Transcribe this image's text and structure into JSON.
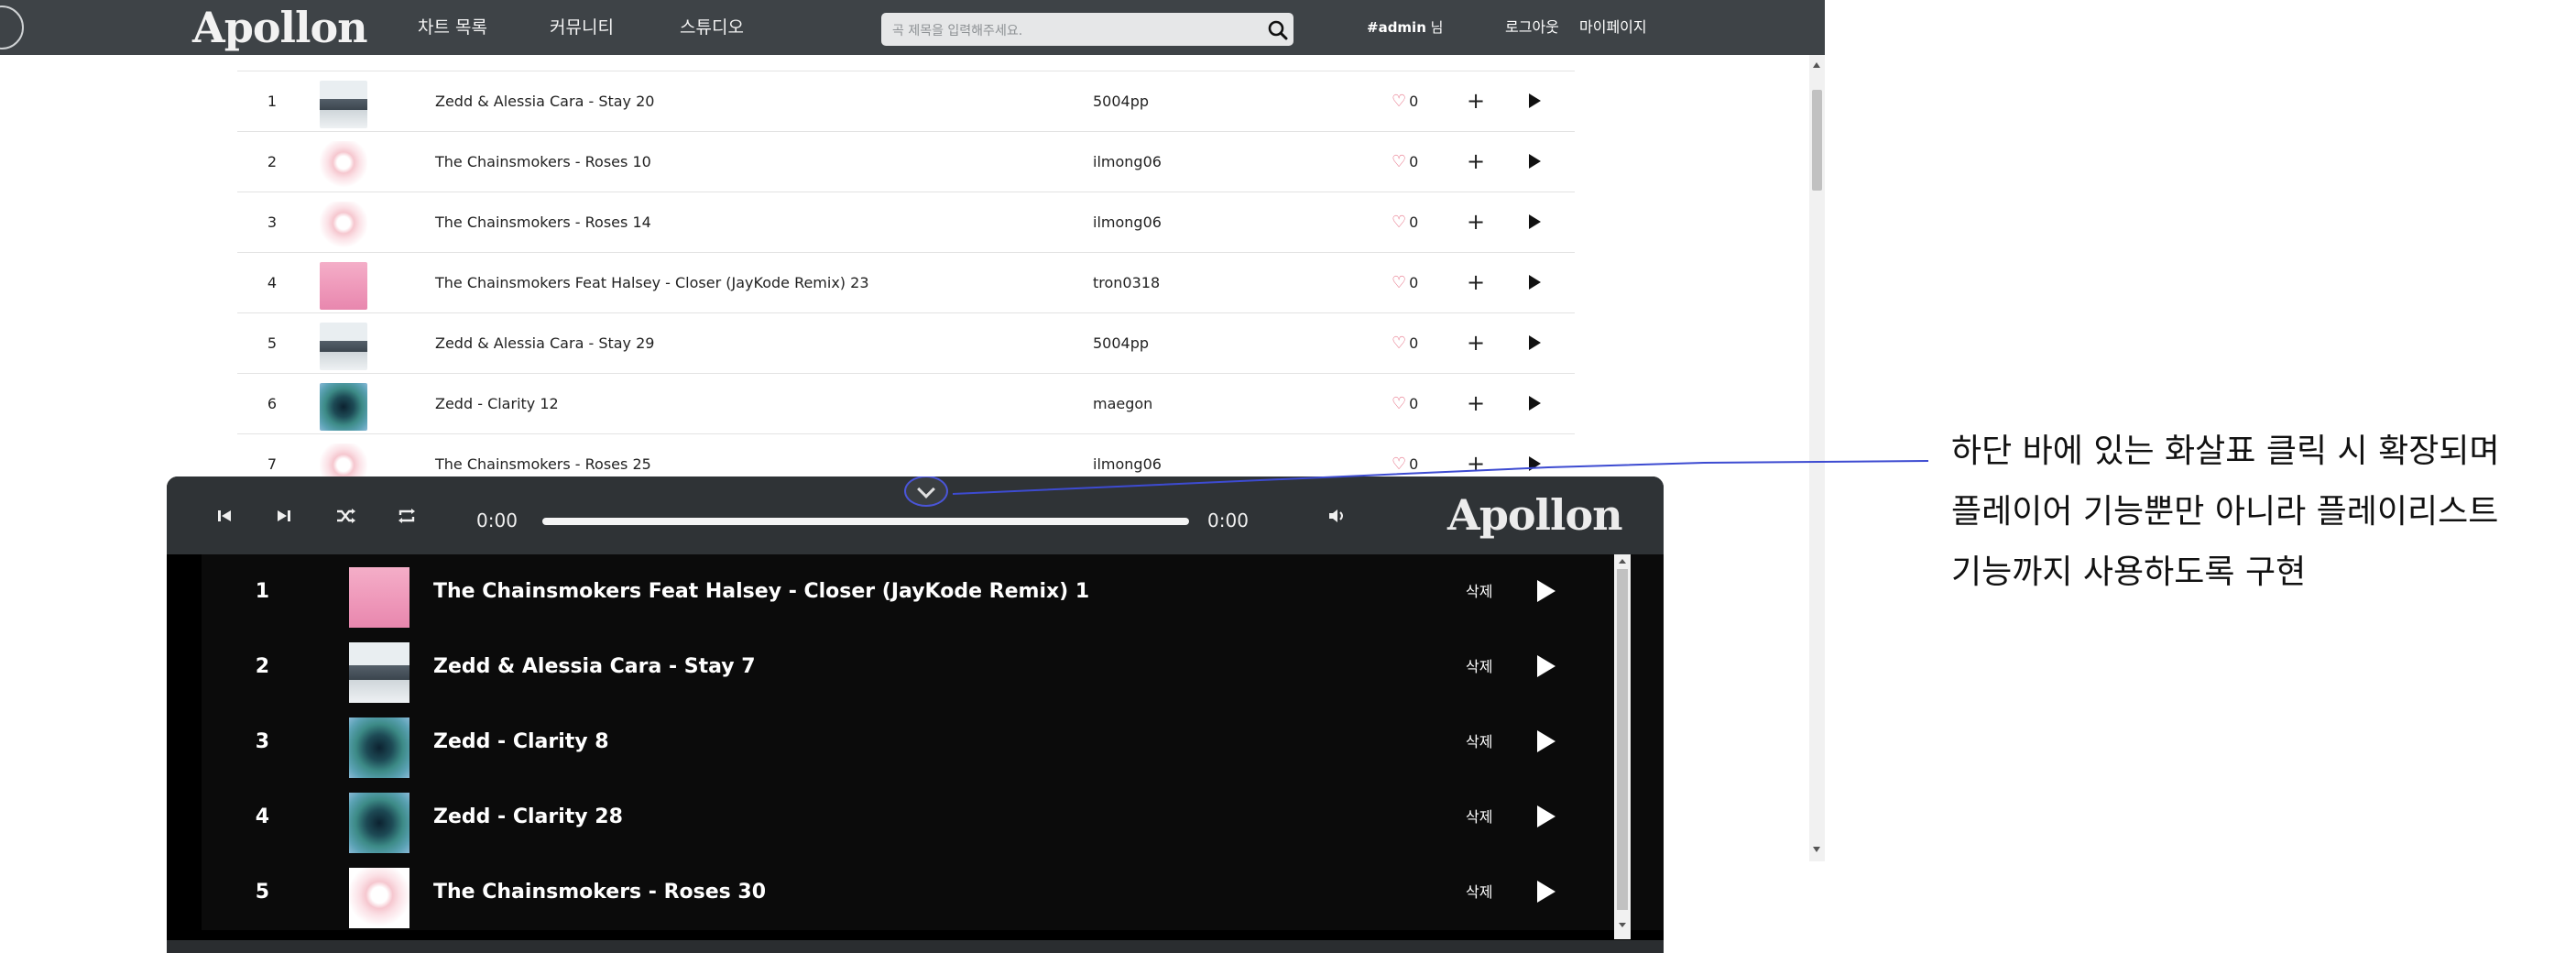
{
  "nav": {
    "logo": "Apollon",
    "menu": [
      {
        "label": "차트 목록"
      },
      {
        "label": "커뮤니티"
      },
      {
        "label": "스튜디오"
      }
    ],
    "search_placeholder": "곡 제목을 입력해주세요.",
    "user_tag": "#admin",
    "user_suffix": "님",
    "logout": "로그아웃",
    "mypage": "마이페이지"
  },
  "chart": {
    "rows": [
      {
        "rank": "1",
        "title": "Zedd & Alessia Cara - Stay 20",
        "uploader": "5004pp",
        "likes": "0",
        "art": "stay"
      },
      {
        "rank": "2",
        "title": "The Chainsmokers - Roses 10",
        "uploader": "ilmong06",
        "likes": "0",
        "art": "roses"
      },
      {
        "rank": "3",
        "title": "The Chainsmokers - Roses 14",
        "uploader": "ilmong06",
        "likes": "0",
        "art": "roses"
      },
      {
        "rank": "4",
        "title": "The Chainsmokers Feat Halsey - Closer (JayKode Remix) 23",
        "uploader": "tron0318",
        "likes": "0",
        "art": "closer"
      },
      {
        "rank": "5",
        "title": "Zedd & Alessia Cara - Stay 29",
        "uploader": "5004pp",
        "likes": "0",
        "art": "stay"
      },
      {
        "rank": "6",
        "title": "Zedd - Clarity 12",
        "uploader": "maegon",
        "likes": "0",
        "art": "clarity"
      },
      {
        "rank": "7",
        "title": "The Chainsmokers - Roses 25",
        "uploader": "ilmong06",
        "likes": "0",
        "art": "roses"
      }
    ],
    "add_symbol": "+"
  },
  "player": {
    "time_current": "0:00",
    "time_total": "0:00",
    "progress": 0,
    "logo": "Apollon",
    "icons": [
      "skip-back-icon",
      "skip-forward-icon",
      "shuffle-icon",
      "repeat-icon",
      "volume-icon",
      "chevron-down-icon"
    ],
    "playlist": [
      {
        "rank": "1",
        "title": "The Chainsmokers Feat Halsey - Closer (JayKode Remix) 1",
        "art": "closer",
        "delete_label": "삭제"
      },
      {
        "rank": "2",
        "title": "Zedd & Alessia Cara - Stay 7",
        "art": "stay",
        "delete_label": "삭제"
      },
      {
        "rank": "3",
        "title": "Zedd - Clarity 8",
        "art": "clarity",
        "delete_label": "삭제"
      },
      {
        "rank": "4",
        "title": "Zedd - Clarity 28",
        "art": "clarity",
        "delete_label": "삭제"
      },
      {
        "rank": "5",
        "title": "The Chainsmokers - Roses 30",
        "art": "roses",
        "delete_label": "삭제"
      }
    ]
  },
  "annotation": {
    "lines": [
      "하단 바에 있는 화살표 클릭 시 확장되며",
      "플레이어 기능뿐만 아니라 플레이리스트",
      "기능까지 사용하도록 구현"
    ],
    "connector_color": "#3d4bd1"
  }
}
